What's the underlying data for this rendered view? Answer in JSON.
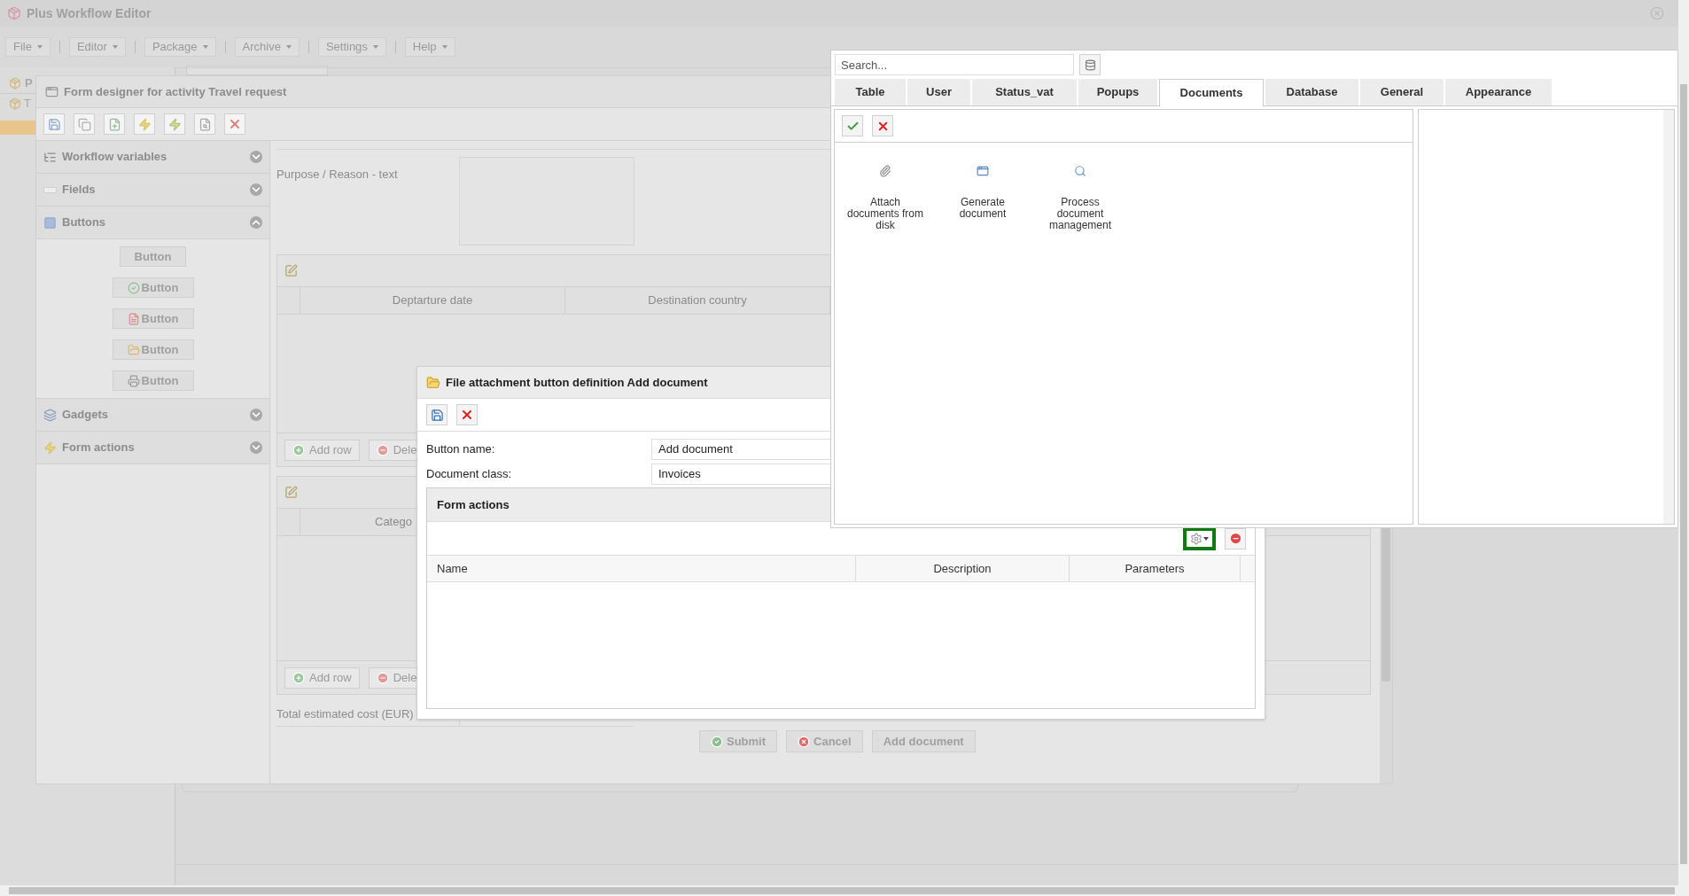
{
  "window": {
    "title": "Plus Workflow Editor"
  },
  "menu": [
    {
      "label": "File"
    },
    {
      "label": "Editor"
    },
    {
      "label": "Package"
    },
    {
      "label": "Archive"
    },
    {
      "label": "Settings"
    },
    {
      "label": "Help"
    }
  ],
  "tree": {
    "tab_label": "P",
    "items": [
      {
        "label": "T",
        "selected": false
      }
    ]
  },
  "form_designer": {
    "title": "Form designer for activity Travel request",
    "accordion": [
      {
        "label": "Workflow variables",
        "kind": "variables",
        "expanded": false
      },
      {
        "label": "Fields",
        "kind": "fields",
        "expanded": false
      },
      {
        "label": "Buttons",
        "kind": "buttons",
        "expanded": true,
        "items": [
          {
            "label": "Button",
            "kind": "plain"
          },
          {
            "label": "Button",
            "kind": "approve"
          },
          {
            "label": "Button",
            "kind": "pdf"
          },
          {
            "label": "Button",
            "kind": "attach"
          },
          {
            "label": "Button",
            "kind": "print"
          }
        ]
      },
      {
        "label": "Gadgets",
        "kind": "gadgets",
        "expanded": false
      },
      {
        "label": "Form actions",
        "kind": "actions",
        "expanded": false
      }
    ],
    "canvas": {
      "text_field": {
        "label": "Purpose / Reason - text"
      },
      "tables": [
        {
          "columns": [
            "Deptarture date",
            "Destination country"
          ],
          "buttons": [
            {
              "label": "Add row",
              "kind": "add"
            },
            {
              "label": "Dele",
              "kind": "delete"
            }
          ]
        },
        {
          "columns": [
            "Catego"
          ],
          "buttons": [
            {
              "label": "Add row",
              "kind": "add"
            },
            {
              "label": "Dele",
              "kind": "delete"
            }
          ]
        }
      ],
      "total": {
        "label": "Total estimated cost (EUR)"
      },
      "buttons": [
        {
          "label": "Submit",
          "kind": "submit"
        },
        {
          "label": "Cancel",
          "kind": "cancel"
        },
        {
          "label": "Add document",
          "kind": "plain"
        }
      ]
    }
  },
  "dialog": {
    "title": "File attachment button definition Add document",
    "fields": [
      {
        "label": "Button name:",
        "value": "Add document"
      },
      {
        "label": "Document class:",
        "value": "Invoices"
      }
    ],
    "form_actions": {
      "title": "Form actions",
      "add_button": {
        "highlighted": true
      },
      "columns": [
        "Name",
        "Description",
        "Parameters"
      ]
    }
  },
  "popup": {
    "search": {
      "placeholder": "Search..."
    },
    "tabs": [
      {
        "label": "Table",
        "selected": false
      },
      {
        "label": "User",
        "selected": false
      },
      {
        "label": "Status_vat",
        "selected": false
      },
      {
        "label": "Popups",
        "selected": false
      },
      {
        "label": "Documents",
        "selected": true
      },
      {
        "label": "Database",
        "selected": false
      },
      {
        "label": "General",
        "selected": false
      },
      {
        "label": "Appearance",
        "selected": false
      }
    ],
    "items": [
      {
        "label": "Attach documents from disk",
        "kind": "attach"
      },
      {
        "label": "Generate document",
        "kind": "generate"
      },
      {
        "label": "Process document management",
        "kind": "search"
      }
    ]
  }
}
